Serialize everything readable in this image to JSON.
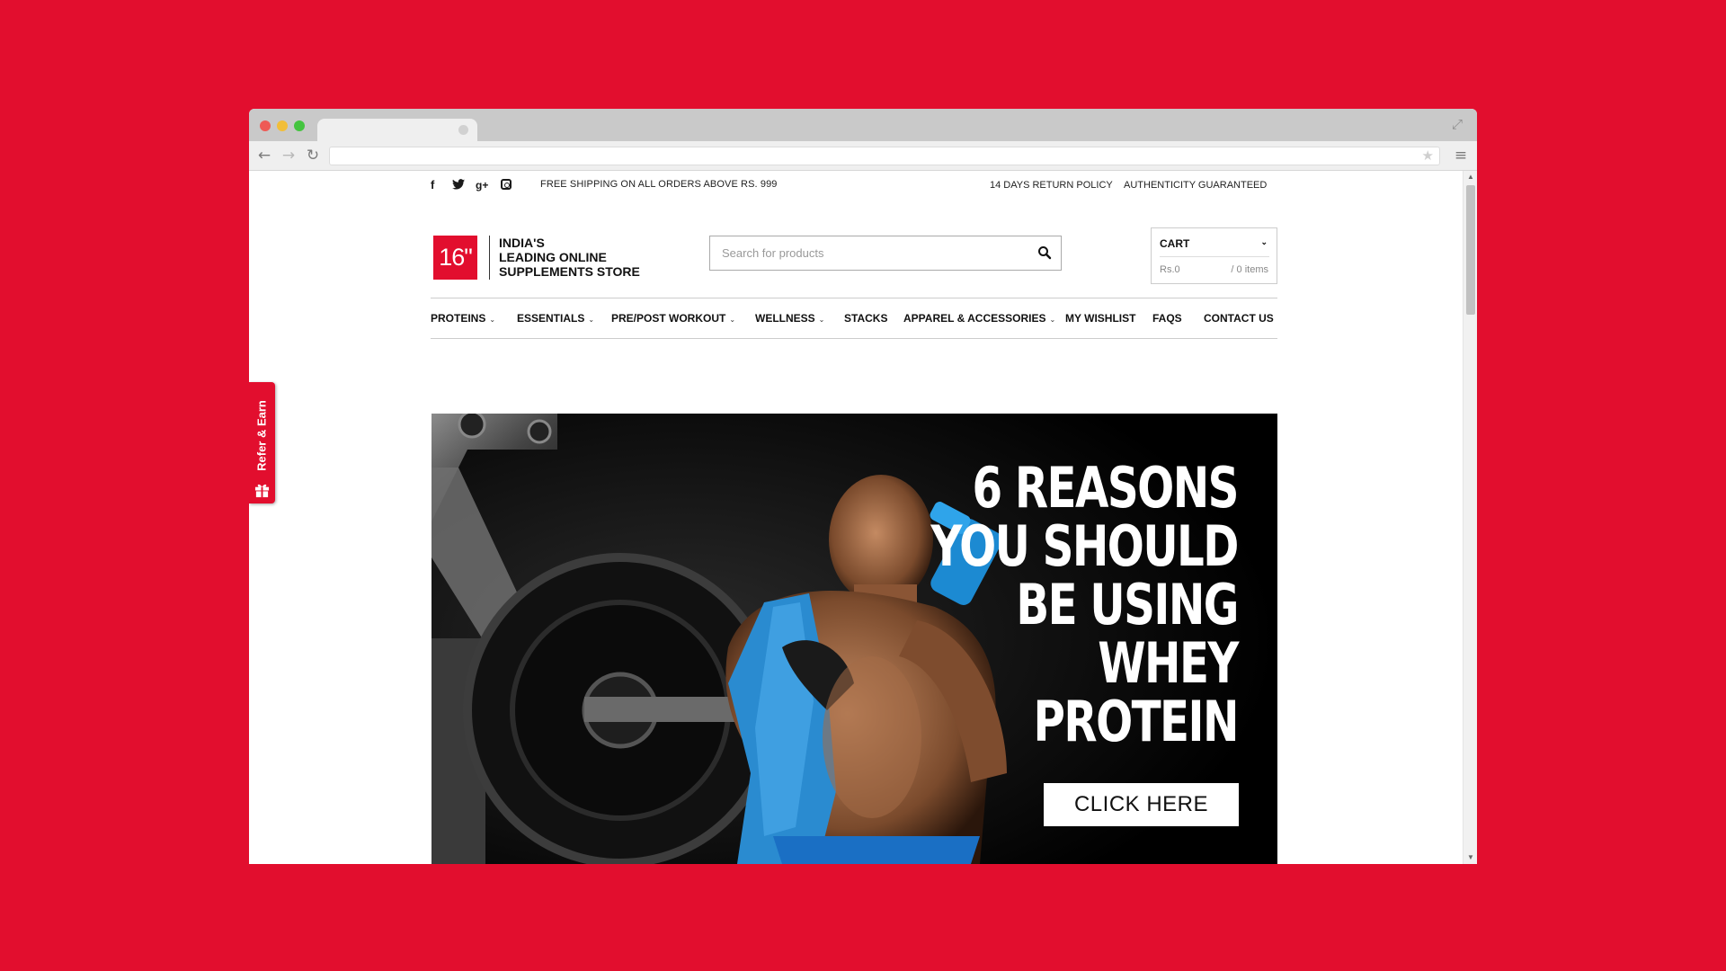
{
  "colors": {
    "brand_red": "#e20e2e",
    "text_dark": "#111111",
    "muted": "#888888"
  },
  "browser": {
    "icons": {
      "back": "arrow-left-icon",
      "forward": "arrow-right-icon",
      "reload": "reload-icon",
      "star": "star-icon",
      "menu": "hamburger-menu-icon",
      "expand": "expand-icon"
    }
  },
  "topbar": {
    "social_icons": [
      "facebook-icon",
      "twitter-icon",
      "google-plus-icon",
      "instagram-icon"
    ],
    "shipping": "FREE SHIPPING ON ALL ORDERS ABOVE RS. 999",
    "return_policy": "14 DAYS RETURN POLICY",
    "authenticity": "AUTHENTICITY GUARANTEED"
  },
  "header": {
    "logo_text": "16\"",
    "tagline": [
      "INDIA'S",
      "LEADING ONLINE",
      "SUPPLEMENTS STORE"
    ],
    "search_placeholder": "Search for products",
    "cart": {
      "title": "CART",
      "amount": "Rs.0",
      "items": "/ 0 items"
    }
  },
  "nav": {
    "items": [
      {
        "label": "PROTEINS",
        "dropdown": true
      },
      {
        "label": "ESSENTIALS",
        "dropdown": true
      },
      {
        "label": "PRE/POST WORKOUT",
        "dropdown": true
      },
      {
        "label": "WELLNESS",
        "dropdown": true
      },
      {
        "label": "STACKS",
        "dropdown": false
      },
      {
        "label": "APPAREL & ACCESSORIES",
        "dropdown": true
      },
      {
        "label": "MY WISHLIST",
        "dropdown": false
      },
      {
        "label": "FAQS",
        "dropdown": false
      },
      {
        "label": "CONTACT US",
        "dropdown": false
      }
    ]
  },
  "refer": {
    "label": "Refer & Earn",
    "icon": "gift-icon"
  },
  "hero": {
    "headline": [
      "6 REASONS",
      "YOU SHOULD",
      "BE USING",
      "WHEY",
      "PROTEIN"
    ],
    "cta": "CLICK HERE"
  }
}
